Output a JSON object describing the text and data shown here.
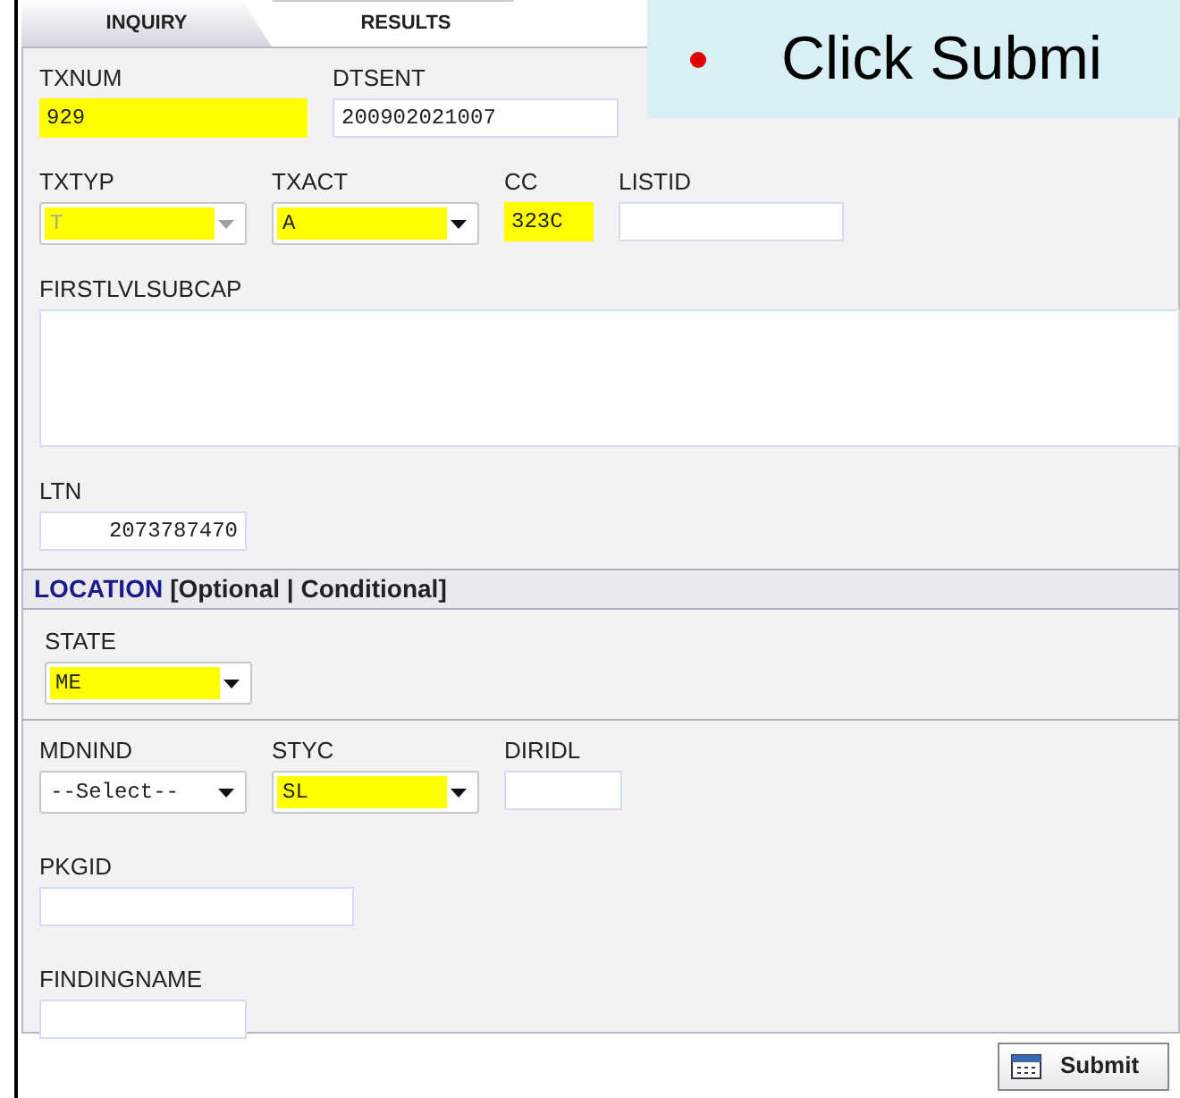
{
  "tabs": [
    {
      "label": "INQUIRY",
      "selected": true
    },
    {
      "label": "RESULTS",
      "selected": false
    }
  ],
  "callout": {
    "text": "Click Submi"
  },
  "rows": [
    [
      {
        "label": "TXNUM",
        "kind": "text",
        "value": "929",
        "highlighted": true
      },
      {
        "label": "DTSENT",
        "kind": "text",
        "value": "200902021007",
        "highlighted": false
      }
    ],
    [
      {
        "label": "TXTYP",
        "kind": "select",
        "value": "T",
        "highlighted": true,
        "disabled": true
      },
      {
        "label": "TXACT",
        "kind": "select",
        "value": "A",
        "highlighted": true,
        "disabled": false
      },
      {
        "label": "CC",
        "kind": "text",
        "value": "323C",
        "highlighted": true
      },
      {
        "label": "LISTID",
        "kind": "text",
        "highlighted": false
      }
    ],
    [
      {
        "label": "FIRSTLVLSUBCAP",
        "kind": "textarea",
        "highlighted": false
      }
    ],
    [
      {
        "label": "LTN",
        "kind": "text",
        "value": "2073787470",
        "highlighted": false
      }
    ]
  ],
  "location": {
    "title": "LOCATION",
    "note": "[Optional | Conditional]",
    "rows": [
      [
        {
          "label": "STATE",
          "kind": "select",
          "value": "ME",
          "highlighted": true,
          "disabled": false
        }
      ]
    ]
  },
  "rows_after": [
    [
      {
        "label": "MDNIND",
        "kind": "select",
        "value": "--Select--",
        "highlighted": false,
        "disabled": false
      },
      {
        "label": "STYC",
        "kind": "select",
        "value": "SL",
        "highlighted": true,
        "disabled": false
      },
      {
        "label": "DIRIDL",
        "kind": "text",
        "highlighted": false
      }
    ],
    [
      {
        "label": "PKGID",
        "kind": "text",
        "highlighted": false
      }
    ],
    [
      {
        "label": "FINDINGNAME",
        "kind": "text",
        "highlighted": false
      }
    ]
  ],
  "submit": {
    "label": "Submit"
  }
}
